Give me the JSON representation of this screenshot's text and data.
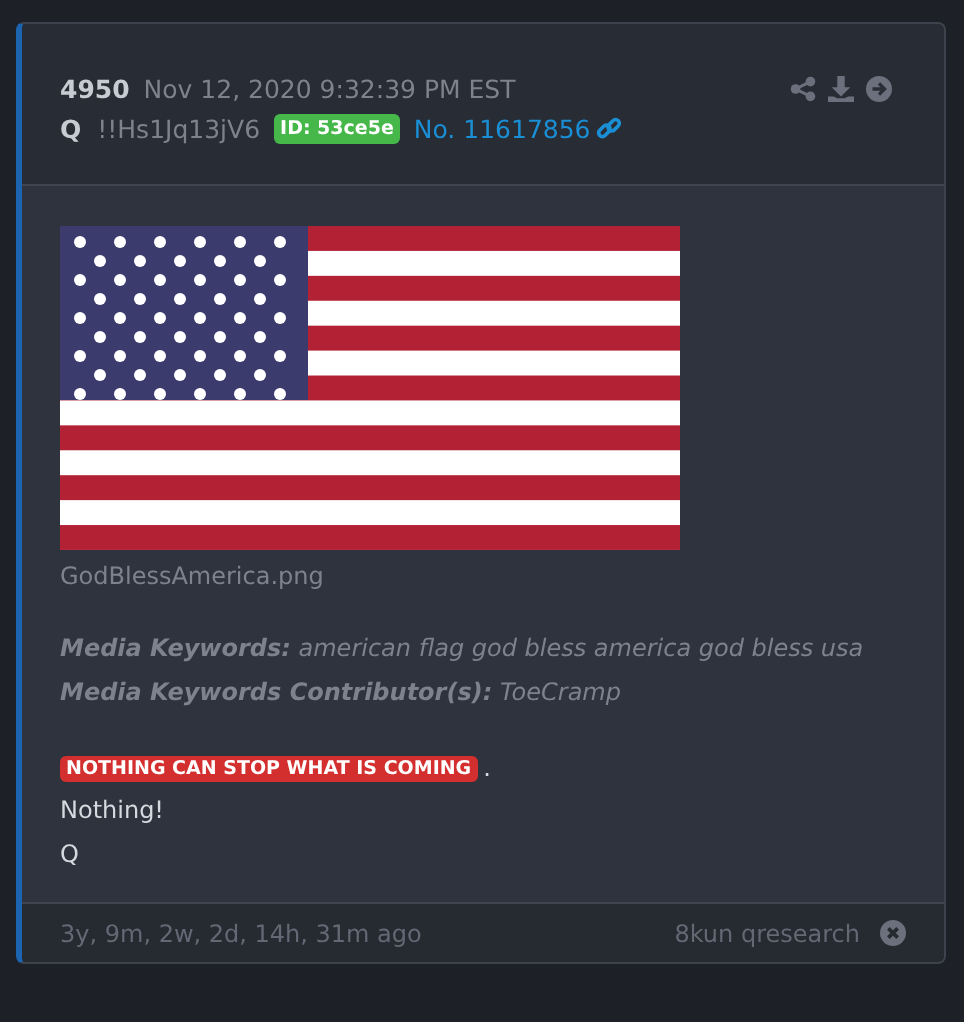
{
  "post": {
    "number": "4950",
    "timestamp": "Nov 12, 2020 9:32:39 PM EST",
    "author": "Q",
    "tripcode": "!!Hs1Jq13jV6",
    "id_badge": "ID: 53ce5e",
    "post_link": "No. 11617856"
  },
  "attachment": {
    "kind": "picture",
    "filename": "GodBlessAmerica.png"
  },
  "keywords": [
    {
      "label": "Media Keywords:",
      "value": "american flag god bless america god bless usa"
    },
    {
      "label": "Media Keywords Contributor(s):",
      "value": "ToeCramp"
    }
  ],
  "message": {
    "highlight": "NOTHING CAN STOP WHAT IS COMING",
    "highlight_suffix": ".",
    "lines": [
      "Nothing!",
      "Q"
    ]
  },
  "footer": {
    "age": "3y, 9m, 2w, 2d, 14h, 31m ago",
    "source": "8kun qresearch"
  }
}
